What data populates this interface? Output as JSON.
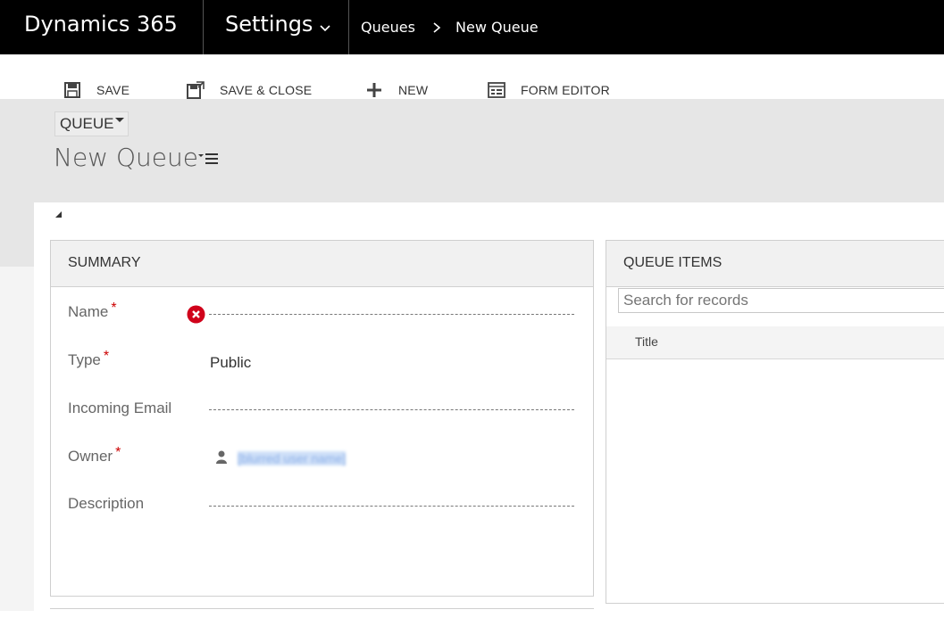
{
  "app": {
    "brand": "Dynamics 365",
    "area": "Settings",
    "breadcrumb": [
      "Queues",
      "New Queue"
    ]
  },
  "commands": {
    "save": "SAVE",
    "save_close": "SAVE & CLOSE",
    "new": "NEW",
    "form_editor": "FORM EDITOR"
  },
  "header": {
    "entity": "QUEUE",
    "record_title": "New Queue"
  },
  "summary": {
    "title": "SUMMARY",
    "fields": {
      "name": {
        "label": "Name",
        "required": "*",
        "value": ""
      },
      "type": {
        "label": "Type",
        "required": "*",
        "value": "Public"
      },
      "incoming_email": {
        "label": "Incoming Email",
        "value": ""
      },
      "owner": {
        "label": "Owner",
        "required": "*",
        "value": "[blurred user name]"
      },
      "description": {
        "label": "Description",
        "value": ""
      }
    }
  },
  "queue_items": {
    "title": "QUEUE ITEMS",
    "search_placeholder": "Search for records",
    "columns": [
      "Title"
    ]
  },
  "colors": {
    "topbar": "#000000",
    "header_bg": "#e6e6e6",
    "required": "#cc0000",
    "error": "#d0021b"
  },
  "icons": {
    "save": "floppy-disk-icon",
    "save_close": "save-close-icon",
    "new": "plus-icon",
    "form_editor": "form-editor-icon",
    "area_chevron": "chevron-down-icon",
    "breadcrumb_sep": "chevron-right-icon",
    "name_error": "error-icon",
    "owner": "user-icon"
  }
}
